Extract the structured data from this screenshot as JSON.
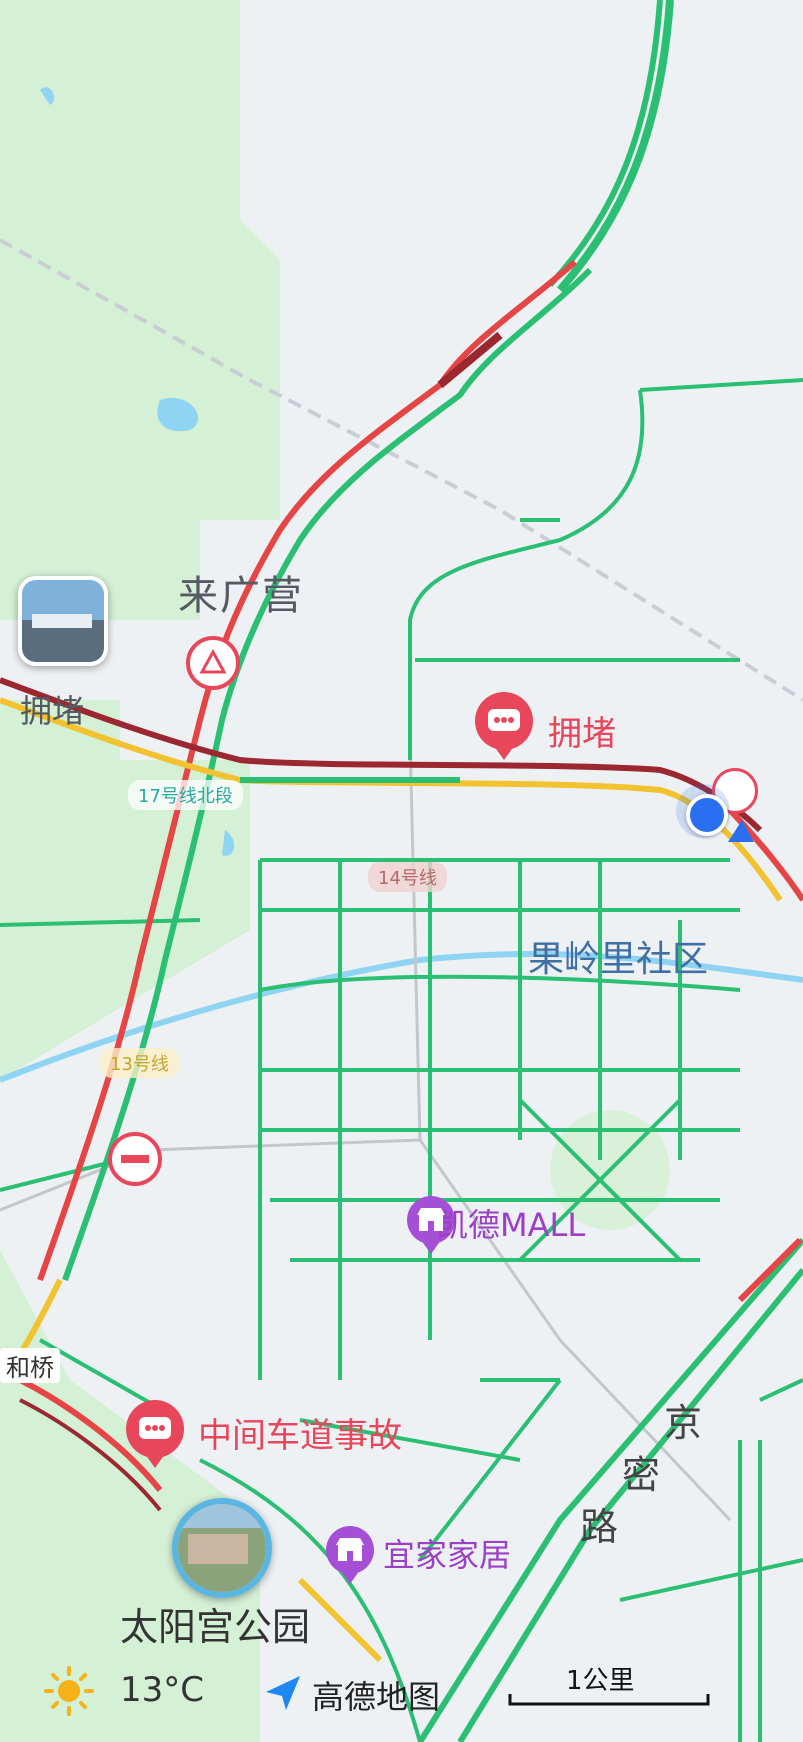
{
  "map": {
    "area_labels": {
      "laiguangying": "来广营"
    },
    "traffic_labels": {
      "congestion_left": "拥堵",
      "congestion_center": "拥堵",
      "accident": "中间车道事故"
    },
    "poi_labels": {
      "mall": "凯德MALL",
      "ikea": "宜家家居",
      "community": "果岭里社区",
      "park": "太阳宫公园",
      "bridge": "和桥"
    },
    "metro_lines": {
      "line17": "17号线北段",
      "line14": "14号线",
      "line13": "13号线"
    },
    "road_labels": {
      "jingmi_road": [
        "京",
        "密",
        "路"
      ]
    },
    "colors": {
      "smooth": "#2bbf74",
      "slow": "#f2c230",
      "jam": "#e64545",
      "heavy_jam": "#9b2730",
      "river": "#8fd4f2",
      "green_area": "#d4f0d5",
      "background": "#eef1f4",
      "location_dot": "#2a6ff0"
    }
  },
  "bottom_bar": {
    "temperature": "13°C",
    "weather_icon": "sun-icon",
    "brand": "高德地图",
    "scale": "1公里"
  }
}
